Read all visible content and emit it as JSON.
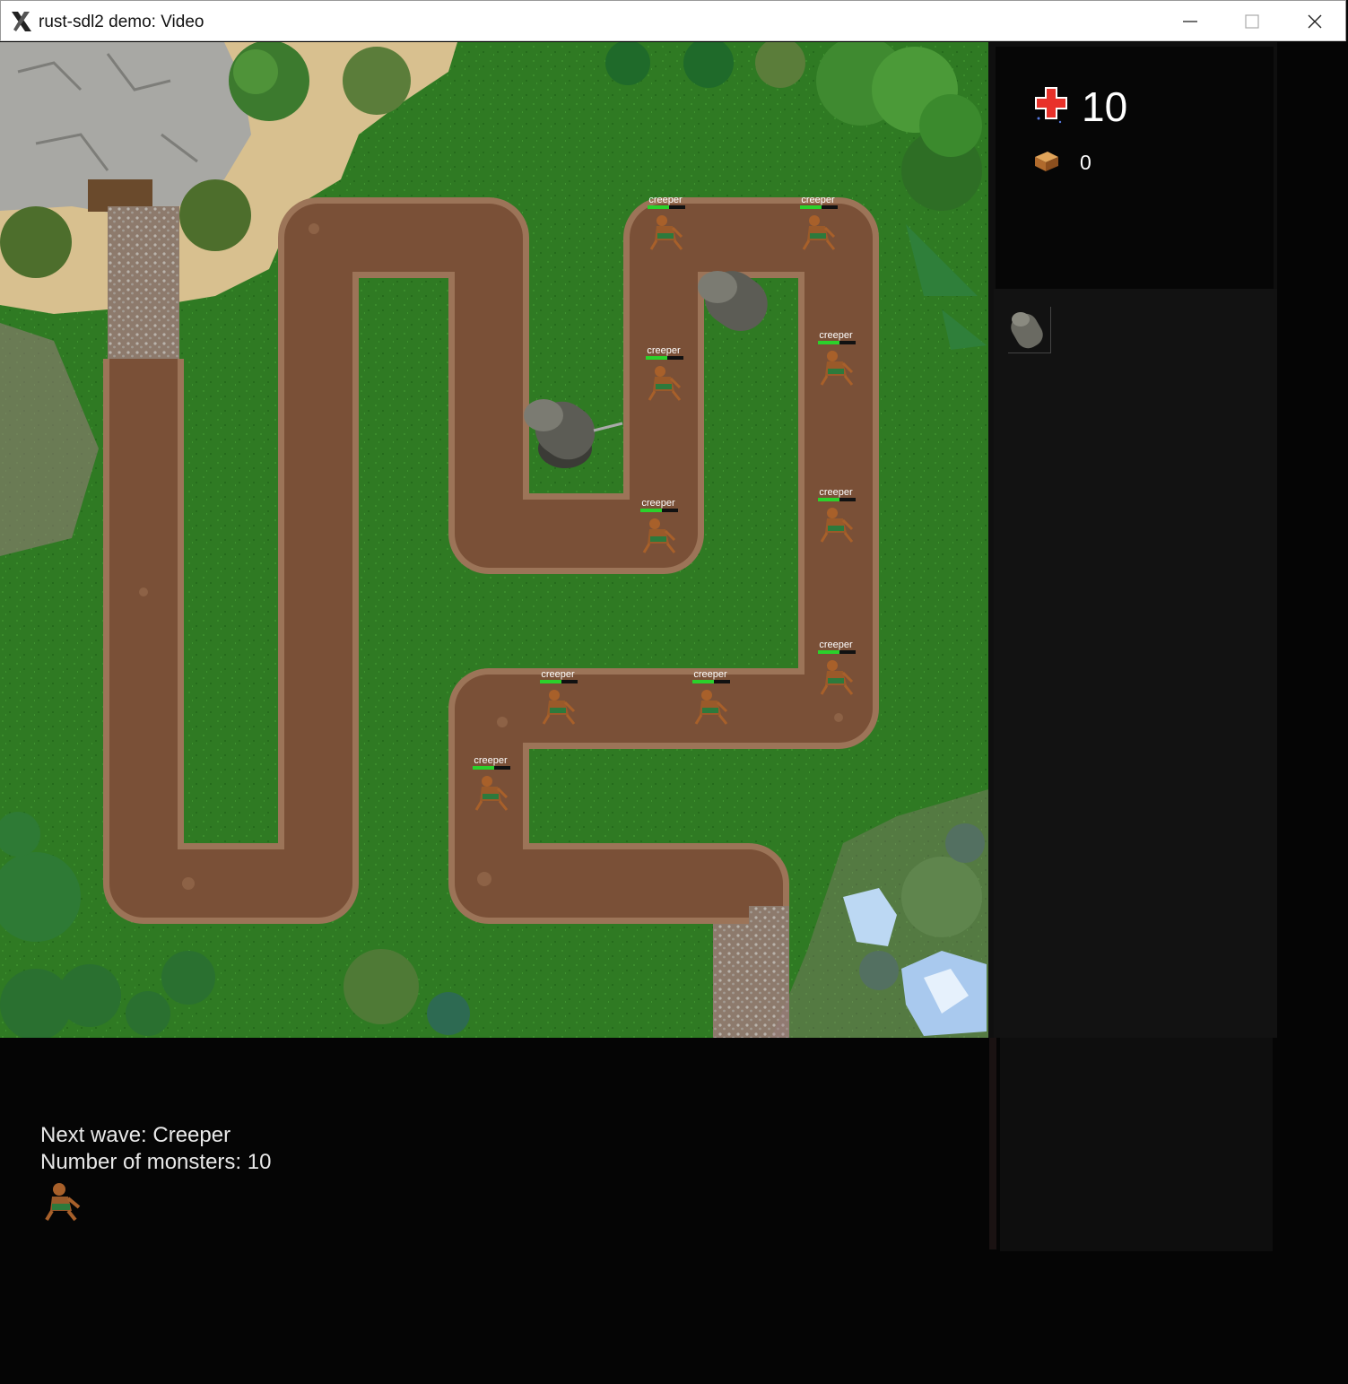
{
  "window": {
    "title": "rust-sdl2 demo: Video"
  },
  "hud": {
    "lives": "10",
    "gold": "0"
  },
  "next_wave": {
    "label": "Next wave: Creeper",
    "count_label": "Number of monsters: 10"
  },
  "monsters": {
    "name": "creeper"
  },
  "colors": {
    "grass": "#2f7a23",
    "path": "#7a5037",
    "path_edge": "#9c7458",
    "health": "#2bd12b"
  }
}
